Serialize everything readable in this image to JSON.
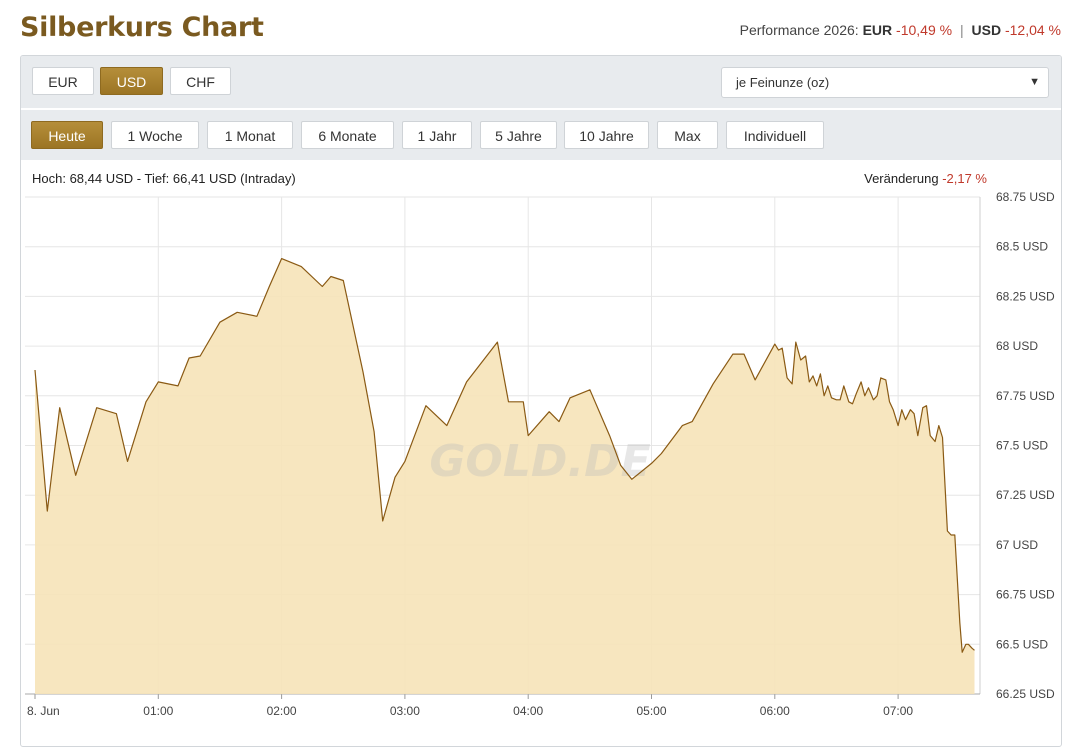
{
  "header": {
    "title": "Silberkurs Chart",
    "performance_label": "Performance 2026:",
    "eur_label": "EUR",
    "eur_value": "-10,49 %",
    "separator": "|",
    "usd_label": "USD",
    "usd_value": "-12,04 %"
  },
  "currency_buttons": [
    {
      "label": "EUR",
      "active": false
    },
    {
      "label": "USD",
      "active": true
    },
    {
      "label": "CHF",
      "active": false
    }
  ],
  "unit_select": {
    "value": "je Feinunze (oz)"
  },
  "range_buttons": [
    {
      "label": "Heute",
      "active": true
    },
    {
      "label": "1 Woche",
      "active": false
    },
    {
      "label": "1 Monat",
      "active": false
    },
    {
      "label": "6 Monate",
      "active": false
    },
    {
      "label": "1 Jahr",
      "active": false
    },
    {
      "label": "5 Jahre",
      "active": false
    },
    {
      "label": "10 Jahre",
      "active": false
    },
    {
      "label": "Max",
      "active": false
    },
    {
      "label": "Individuell",
      "active": false
    }
  ],
  "info": {
    "high_low": "Hoch: 68,44 USD - Tief: 66,41 USD (Intraday)",
    "change_label": "Veränderung",
    "change_value": "-2,17 %"
  },
  "colors": {
    "accent": "#a47c2c",
    "line": "#8a5a14",
    "fill": "#f6e3b8",
    "negative": "#c0392b"
  },
  "chart_data": {
    "type": "area",
    "watermark": "GOLD.DE",
    "x_tick_labels": [
      "8. Jun",
      "01:00",
      "02:00",
      "03:00",
      "04:00",
      "05:00",
      "06:00",
      "07:00"
    ],
    "y_tick_labels": [
      "66.25 USD",
      "66.5 USD",
      "66.75 USD",
      "67 USD",
      "67.25 USD",
      "67.5 USD",
      "67.75 USD",
      "68 USD",
      "68.25 USD",
      "68.5 USD",
      "68.75 USD"
    ],
    "ylim": [
      66.25,
      68.75
    ],
    "xlim_hours": [
      0,
      7.62
    ],
    "grid": true,
    "series": [
      {
        "x": [
          0.0,
          0.1,
          0.2,
          0.33,
          0.5,
          0.66,
          0.75,
          0.9,
          1.0,
          1.16,
          1.25,
          1.34,
          1.5,
          1.64,
          1.8,
          1.9,
          2.0,
          2.16,
          2.33,
          2.4,
          2.5,
          2.66,
          2.75,
          2.82,
          2.92,
          3.0,
          3.17,
          3.34,
          3.5,
          3.75,
          3.84,
          3.96,
          4.0,
          4.17,
          4.25,
          4.34,
          4.5,
          4.66,
          4.75,
          4.84,
          5.0,
          5.08,
          5.25,
          5.33,
          5.5,
          5.66,
          5.75,
          5.84,
          6.0,
          6.03,
          6.06,
          6.1,
          6.14,
          6.17,
          6.21,
          6.25,
          6.28,
          6.31,
          6.34,
          6.37,
          6.4,
          6.43,
          6.46,
          6.5,
          6.53,
          6.56,
          6.6,
          6.63,
          6.66,
          6.7,
          6.73,
          6.76,
          6.8,
          6.83,
          6.86,
          6.9,
          6.93,
          6.96,
          7.0,
          7.03,
          7.06,
          7.1,
          7.13,
          7.16,
          7.2,
          7.23,
          7.26,
          7.3,
          7.33,
          7.36,
          7.4,
          7.43,
          7.46,
          7.5,
          7.52,
          7.55,
          7.57,
          7.6,
          7.62
        ],
        "values": [
          67.88,
          67.17,
          67.69,
          67.35,
          67.69,
          67.66,
          67.42,
          67.72,
          67.82,
          67.8,
          67.94,
          67.95,
          68.12,
          68.17,
          68.15,
          68.3,
          68.44,
          68.4,
          68.3,
          68.35,
          68.33,
          67.87,
          67.57,
          67.12,
          67.34,
          67.42,
          67.7,
          67.6,
          67.82,
          68.02,
          67.72,
          67.72,
          67.55,
          67.67,
          67.62,
          67.74,
          67.78,
          67.55,
          67.4,
          67.33,
          67.41,
          67.46,
          67.6,
          67.62,
          67.81,
          67.96,
          67.96,
          67.83,
          68.01,
          67.98,
          67.99,
          67.84,
          67.81,
          68.02,
          67.93,
          67.95,
          67.82,
          67.85,
          67.8,
          67.86,
          67.75,
          67.8,
          67.74,
          67.73,
          67.73,
          67.8,
          67.72,
          67.71,
          67.76,
          67.82,
          67.75,
          67.79,
          67.73,
          67.75,
          67.84,
          67.83,
          67.72,
          67.68,
          67.6,
          67.68,
          67.63,
          67.68,
          67.66,
          67.55,
          67.69,
          67.7,
          67.55,
          67.52,
          67.6,
          67.54,
          67.07,
          67.05,
          67.05,
          66.61,
          66.46,
          66.5,
          66.5,
          66.48,
          66.47
        ]
      }
    ]
  }
}
